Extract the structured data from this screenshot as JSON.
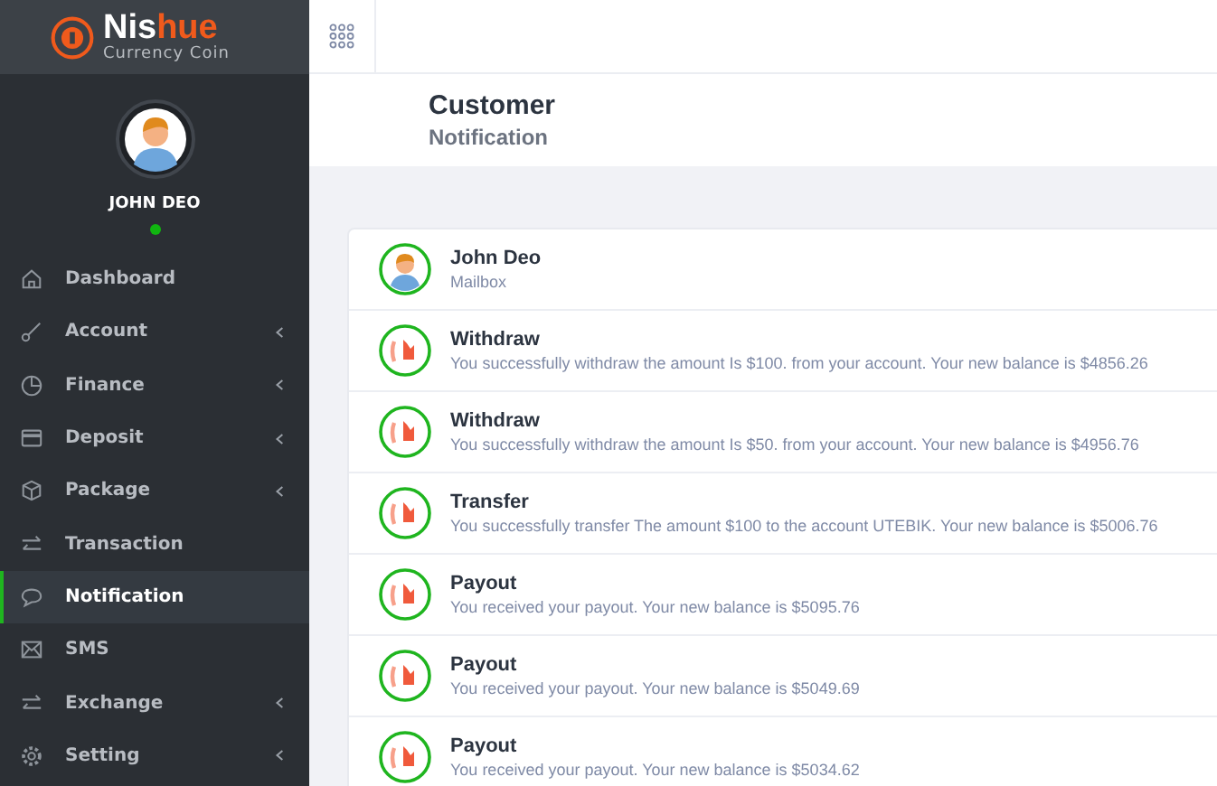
{
  "brand": {
    "name_light": "Nis",
    "name_accent": "hue",
    "tagline": "Currency Coin"
  },
  "profile": {
    "name": "JOHN DEO",
    "online": true
  },
  "sidebar": {
    "items": [
      {
        "label": "Dashboard",
        "submenu": false,
        "selected": false
      },
      {
        "label": "Account",
        "submenu": true,
        "selected": false
      },
      {
        "label": "Finance",
        "submenu": true,
        "selected": false
      },
      {
        "label": "Deposit",
        "submenu": true,
        "selected": false
      },
      {
        "label": "Package",
        "submenu": true,
        "selected": false
      },
      {
        "label": "Transaction",
        "submenu": false,
        "selected": false
      },
      {
        "label": "Notification",
        "submenu": false,
        "selected": true
      },
      {
        "label": "SMS",
        "submenu": false,
        "selected": false
      },
      {
        "label": "Exchange",
        "submenu": true,
        "selected": false
      },
      {
        "label": "Setting",
        "submenu": true,
        "selected": false
      }
    ]
  },
  "page": {
    "title": "Customer",
    "subtitle": "Notification"
  },
  "notifications": [
    {
      "kind": "person",
      "title": "John Deo",
      "text": "Mailbox"
    },
    {
      "kind": "coin",
      "title": "Withdraw",
      "text": "You successfully withdraw the amount Is $100. from your account. Your new balance is $4856.26"
    },
    {
      "kind": "coin",
      "title": "Withdraw",
      "text": "You successfully withdraw the amount Is $50. from your account. Your new balance is $4956.76"
    },
    {
      "kind": "coin",
      "title": "Transfer",
      "text": "You successfully transfer The amount $100 to the account UTEBIK. Your new balance is $5006.76"
    },
    {
      "kind": "coin",
      "title": "Payout",
      "text": "You received your payout. Your new balance is $5095.76"
    },
    {
      "kind": "coin",
      "title": "Payout",
      "text": "You received your payout. Your new balance is $5049.69"
    },
    {
      "kind": "coin",
      "title": "Payout",
      "text": "You received your payout. Your new balance is $5034.62"
    }
  ]
}
